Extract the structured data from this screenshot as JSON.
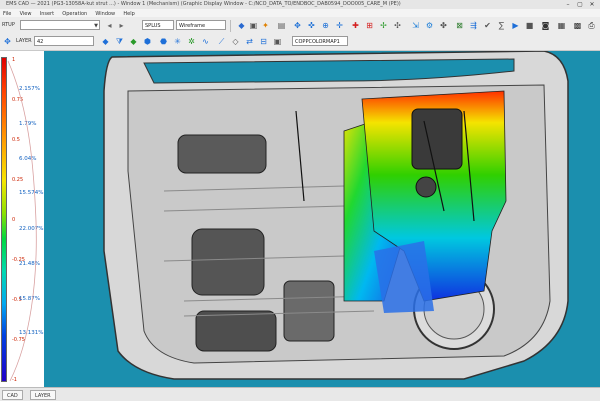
{
  "window": {
    "title": "EMS CAD — 2021 (PG3-13058A-kut strut ...) - Window 1 (Mechanism)  (Graphic Display Window - C:/NCO_DATA_TO/ENDBOC_DAB0594_DOO005_CARE_M (PE))",
    "min": "–",
    "max": "▢",
    "close": "✕"
  },
  "menu": [
    "File",
    "View",
    "Insert",
    "Operation",
    "Window",
    "Help"
  ],
  "toolbar1": {
    "part_field": "SPLUS",
    "view_field": "Wireframe"
  },
  "toolbar2": {
    "layer_label": "LAYER",
    "layer_value": "42",
    "colormap_field": "COPPCOLORMAP1"
  },
  "legend": {
    "values": [
      "1",
      "0.75",
      "0.5",
      "0.25",
      "0",
      "-0.25",
      "-0.5",
      "-0.75",
      "-1"
    ],
    "percents": [
      "2.157%",
      "1.79%",
      "6.04%",
      "15.574%",
      "22.007%",
      "21.48%",
      "15.87%",
      "13.131%"
    ],
    "colors": {
      "max": "#e00000",
      "mid": "#00d840",
      "min": "#2000c8"
    }
  },
  "statusbar": {
    "tab1": "CAD",
    "tab2": "LAYER"
  },
  "colors": {
    "viewport_bg": "#1b8fae",
    "door_panel": "#d4d4d4",
    "door_edge": "#3a3a3a"
  }
}
